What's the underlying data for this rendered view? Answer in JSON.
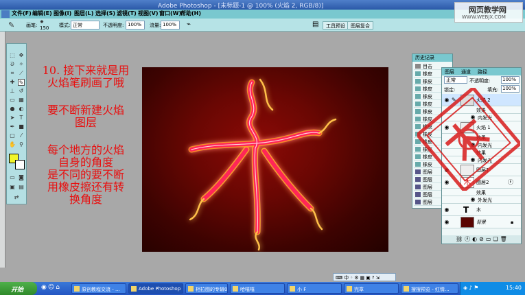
{
  "window": {
    "title": "Adobe Photoshop - [未标题-1 @ 100% (火焰 2, RGB/8)]"
  },
  "watermark": {
    "text": "网页教学网",
    "url": "WWW.WEBJX.COM"
  },
  "menu": [
    "文件(F)",
    "编辑(E)",
    "图像(I)",
    "图层(L)",
    "选择(S)",
    "滤镜(T)",
    "视图(V)",
    "窗口(W)",
    "帮助(H)"
  ],
  "options": {
    "brush_label": "画笔:",
    "brush_size": "150",
    "mode_label": "模式:",
    "mode_value": "正常",
    "opacity_label": "不透明度:",
    "opacity_value": "100%",
    "flow_label": "流量:",
    "flow_value": "100%",
    "tool_presets_tab": "工具预设",
    "layer_comps_tab": "图层复合"
  },
  "instructions": {
    "step1": "10. 接下来就是用",
    "step2": "火焰笔刷画了哦",
    "b2l1": "要不断新建火焰",
    "b2l2": "图层",
    "b3l1": "每个地方的火焰",
    "b3l2": "自身的角度",
    "b3l3": "是不同的要不断",
    "b3l4": "用橡皮擦还有转",
    "b3l5": "换角度"
  },
  "canvas": {
    "character": "木"
  },
  "history": {
    "title": "历史记录",
    "items": [
      "目击",
      "橡皮",
      "橡皮",
      "橡皮",
      "橡皮",
      "橡皮",
      "橡皮",
      "橡皮",
      "橡皮",
      "橡皮",
      "橡皮",
      "橡皮",
      "橡皮",
      "橡皮",
      "图层",
      "图层",
      "图层",
      "图层",
      "图层",
      "图层"
    ]
  },
  "layers": {
    "tabs": [
      "图层",
      "通道",
      "路径"
    ],
    "blend_mode": "正常",
    "opacity_label": "不透明度:",
    "opacity_value": "100%",
    "lock_label": "锁定:",
    "fill_label": "填充:",
    "fill_value": "100%",
    "rows": [
      {
        "name": "火焰 2"
      },
      {
        "name": "效果"
      },
      {
        "name": "内发光"
      },
      {
        "name": "火焰 1"
      },
      {
        "name": "效果"
      },
      {
        "name": "内发光"
      },
      {
        "name": "图层1"
      },
      {
        "name": "图层2"
      },
      {
        "name": "效果"
      },
      {
        "name": "外发光"
      },
      {
        "name": "木"
      },
      {
        "name": "背景"
      }
    ],
    "extra_effect": "内发光",
    "extra_effect2": "效果"
  },
  "taskbar": {
    "start": "开始",
    "tasks": [
      "原创教程交流 - ...",
      "Adobe Photoshop ...",
      "相拉图的专辑09...",
      "哈嘻嘻",
      "小 F",
      "完章",
      "搜搜预览 - 红情..."
    ],
    "clock": "15:40"
  },
  "colors": {
    "menubar": "#79c8cf",
    "instruction_text": "#e81010",
    "foreground_swatch": "#f1f52a",
    "stamp": "#d81c1c"
  }
}
